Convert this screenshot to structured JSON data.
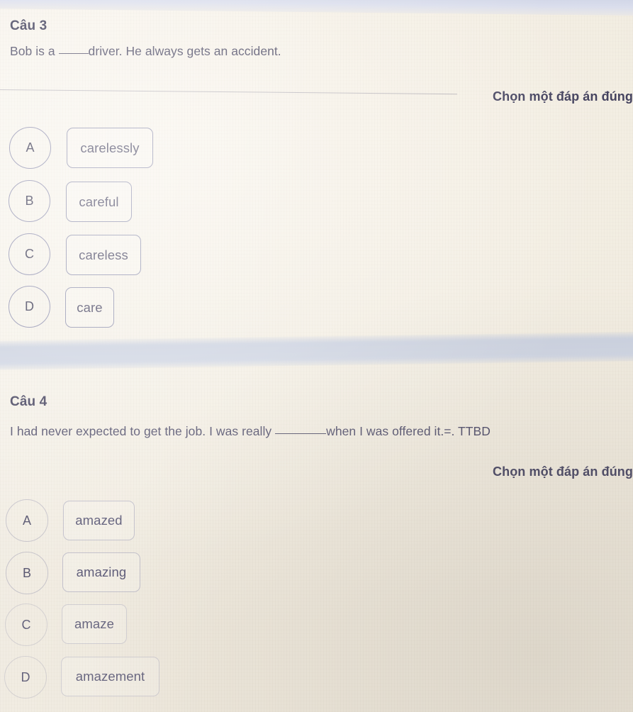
{
  "prompt_label": "Chọn một đáp án đúng",
  "colors": {
    "page_background": "#f4efe5",
    "text": "#4a4862",
    "heading": "#3b3a56",
    "option_border": "#9092ae",
    "band": "#ccd2e0"
  },
  "questions": [
    {
      "number": "Câu 3",
      "text_before_blank": "Bob is a ",
      "text_after_blank": "driver. He always gets an accident.",
      "prompt": "Chọn một đáp án đúng",
      "options": [
        {
          "letter": "A",
          "label": "carelessly"
        },
        {
          "letter": "B",
          "label": "careful"
        },
        {
          "letter": "C",
          "label": "careless"
        },
        {
          "letter": "D",
          "label": "care"
        }
      ]
    },
    {
      "number": "Câu 4",
      "text_before_blank": "I had never expected to get the job. I was really ",
      "text_after_blank": "when I was offered it.=. TTBD",
      "prompt": "Chọn một đáp án đúng",
      "options": [
        {
          "letter": "A",
          "label": "amazed"
        },
        {
          "letter": "B",
          "label": "amazing"
        },
        {
          "letter": "C",
          "label": "amaze"
        },
        {
          "letter": "D",
          "label": "amazement"
        }
      ]
    }
  ]
}
